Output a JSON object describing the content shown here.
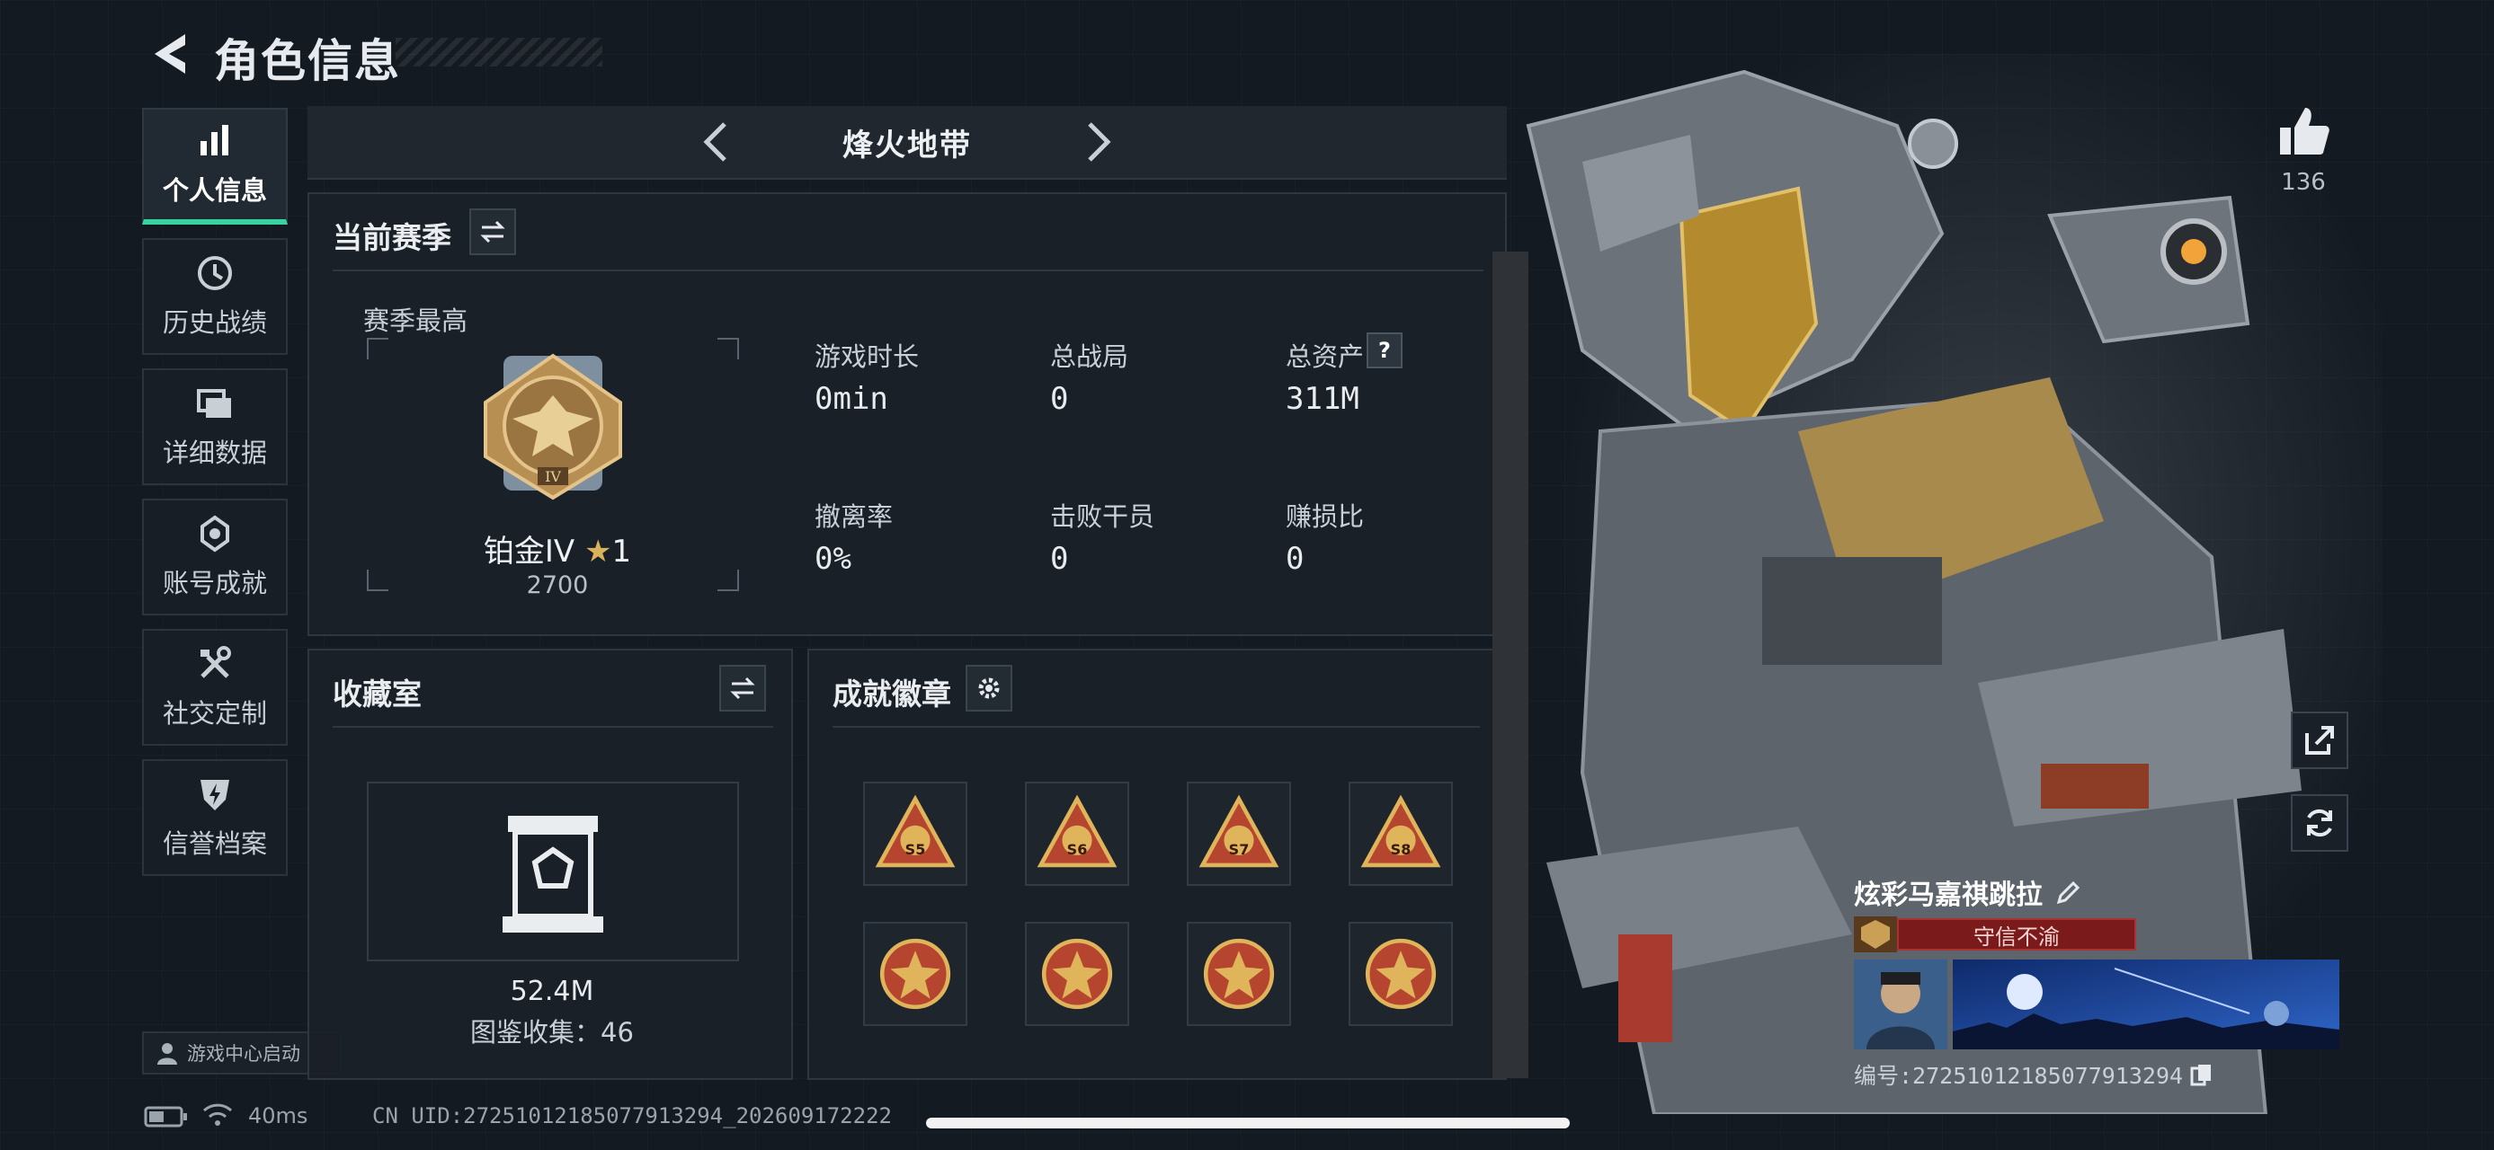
{
  "header": {
    "title": "角色信息"
  },
  "sidebar": {
    "items": [
      {
        "label": "个人信息",
        "icon": "bar-chart-icon",
        "active": true
      },
      {
        "label": "历史战绩",
        "icon": "clock-icon"
      },
      {
        "label": "详细数据",
        "icon": "folder-icon"
      },
      {
        "label": "账号成就",
        "icon": "medal-icon"
      },
      {
        "label": "社交定制",
        "icon": "tools-icon"
      },
      {
        "label": "信誉档案",
        "icon": "shield-bolt-icon"
      }
    ],
    "launch_label": "游戏中心启动"
  },
  "mode": {
    "name": "烽火地带"
  },
  "season": {
    "title": "当前赛季",
    "best_label": "赛季最高",
    "rank_name": "铂金IV",
    "rank_stars": "1",
    "rank_points": "2700",
    "stats": [
      {
        "label": "游戏时长",
        "value": "0min"
      },
      {
        "label": "总战局",
        "value": "0"
      },
      {
        "label": "总资产",
        "value": "311M",
        "help": "?"
      },
      {
        "label": "撤离率",
        "value": "0%"
      },
      {
        "label": "击败干员",
        "value": "0"
      },
      {
        "label": "赚损比",
        "value": "0"
      }
    ]
  },
  "collection": {
    "title": "收藏室",
    "value": "52.4M",
    "catalog_label": "图鉴收集：46"
  },
  "achievements": {
    "title": "成就徽章",
    "badges": [
      {
        "label": "S5",
        "color": "#b5452e"
      },
      {
        "label": "S6",
        "color": "#b5452e"
      },
      {
        "label": "S7",
        "color": "#b5452e"
      },
      {
        "label": "S8",
        "color": "#b5452e"
      },
      {
        "label": "",
        "color": "#b5452e"
      },
      {
        "label": "",
        "color": "#b5452e"
      },
      {
        "label": "",
        "color": "#b5452e"
      },
      {
        "label": "",
        "color": "#b5452e"
      }
    ]
  },
  "likes": {
    "count": "136"
  },
  "player": {
    "name": "炫彩马嘉祺跳拉",
    "title": "守信不渝",
    "uid": "编号:272510121850779132​94"
  },
  "status": {
    "ping": "40ms",
    "cn_uid": "CN UID:272510121850779132​94_202609172222"
  },
  "colors": {
    "accent": "#39d3a0",
    "title_red": "#7b1a1a",
    "gold": "#c9a055"
  }
}
